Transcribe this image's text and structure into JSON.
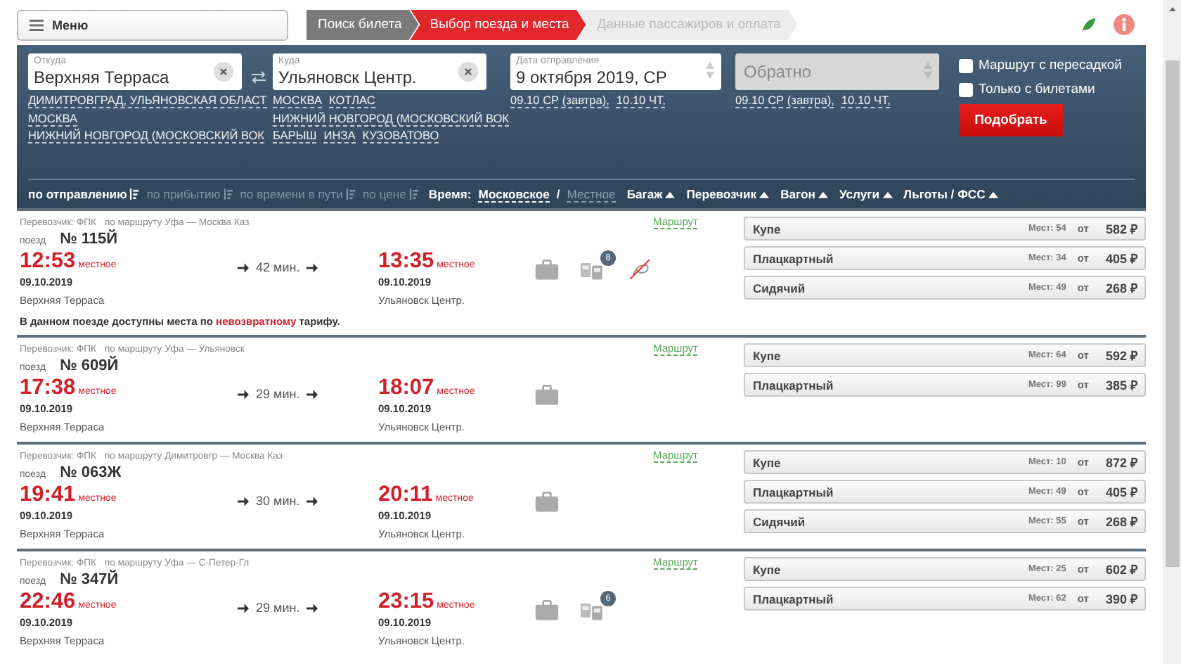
{
  "menu": {
    "label": "Меню"
  },
  "steps": [
    {
      "label": "Поиск билета",
      "kind": "done"
    },
    {
      "label": "Выбор поезда и места",
      "kind": "current"
    },
    {
      "label": "Данные пассажиров и оплата",
      "kind": "pending"
    }
  ],
  "search": {
    "from": {
      "label": "Откуда",
      "value": "Верхняя Терраса",
      "suggestions": [
        [
          "ДИМИТРОВГРАД, УЛЬЯНОВСКАЯ ОБЛАСТ"
        ],
        [
          "МОСКВА"
        ],
        [
          "НИЖНИЙ НОВГОРОД (МОСКОВСКИЙ ВОК"
        ]
      ]
    },
    "to": {
      "label": "Куда",
      "value": "Ульяновск Центр.",
      "suggestions": [
        [
          "МОСКВА",
          "КОТЛАС"
        ],
        [
          "НИЖНИЙ НОВГОРОД (МОСКОВСКИЙ ВОК"
        ],
        [
          "БАРЫШ",
          "ИНЗА",
          "КУЗОВАТОВО"
        ]
      ]
    },
    "date": {
      "label": "Дата отправления",
      "value": "9 октября 2019, СР",
      "quick": [
        "09.10 СР (завтра),",
        "10.10 ЧТ,"
      ]
    },
    "return": {
      "placeholder": "Обратно",
      "quick": [
        "09.10 СР (завтра),",
        "10.10 ЧТ,"
      ]
    },
    "options": [
      {
        "label": "Маршрут с пересадкой",
        "checked": false
      },
      {
        "label": "Только с билетами",
        "checked": false
      }
    ],
    "submit": "Подобрать"
  },
  "sort_bar": {
    "sorts": [
      {
        "label": "по отправлению",
        "selected": true
      },
      {
        "label": "по прибытию",
        "selected": false
      },
      {
        "label": "по времени в пути",
        "selected": false
      },
      {
        "label": "по цене",
        "selected": false
      }
    ],
    "time_label": "Время:",
    "time_separator": "/",
    "time_modes": [
      {
        "label": "Московское",
        "selected": true
      },
      {
        "label": "Местное",
        "selected": false
      }
    ],
    "filters": [
      "Багаж",
      "Перевозчик",
      "Вагон",
      "Услуги",
      "Льготы / ФСС"
    ]
  },
  "trains": [
    {
      "carrier": "Перевозчик: ФПК",
      "route": "по маршруту Уфа — Москва Каз",
      "route_link": "Маршрут",
      "train_label": "поезд",
      "number": "№ 115Й",
      "depart": {
        "time": "12:53",
        "zone": "местное",
        "date": "09.10.2019",
        "station": "Верхняя Терраса"
      },
      "duration": "42 мин.",
      "arrive": {
        "time": "13:35",
        "zone": "местное",
        "date": "09.10.2019",
        "station": "Ульяновск Центр."
      },
      "features": [
        {
          "kind": "luggage"
        },
        {
          "kind": "cars",
          "badge": "8"
        },
        {
          "kind": "no-pets"
        }
      ],
      "note": "В данном поезде доступны места по **невозвратному** тарифу.",
      "classes": [
        {
          "name": "Купе",
          "seats": "Мест: 54",
          "from": "от",
          "price": "582 ₽"
        },
        {
          "name": "Плацкартный",
          "seats": "Мест: 34",
          "from": "от",
          "price": "405 ₽"
        },
        {
          "name": "Сидячий",
          "seats": "Мест: 49",
          "from": "от",
          "price": "268 ₽"
        }
      ]
    },
    {
      "carrier": "Перевозчик: ФПК",
      "route": "по маршруту Уфа — Ульяновск",
      "route_link": "Маршрут",
      "train_label": "поезд",
      "number": "№ 609Й",
      "depart": {
        "time": "17:38",
        "zone": "местное",
        "date": "09.10.2019",
        "station": "Верхняя Терраса"
      },
      "duration": "29 мин.",
      "arrive": {
        "time": "18:07",
        "zone": "местное",
        "date": "09.10.2019",
        "station": "Ульяновск Центр."
      },
      "features": [
        {
          "kind": "luggage"
        }
      ],
      "classes": [
        {
          "name": "Купе",
          "seats": "Мест: 64",
          "from": "от",
          "price": "592 ₽"
        },
        {
          "name": "Плацкартный",
          "seats": "Мест: 99",
          "from": "от",
          "price": "385 ₽"
        }
      ]
    },
    {
      "carrier": "Перевозчик: ФПК",
      "route": "по маршруту Димитровгр — Москва Каз",
      "route_link": "Маршрут",
      "train_label": "поезд",
      "number": "№ 063Ж",
      "depart": {
        "time": "19:41",
        "zone": "местное",
        "date": "09.10.2019",
        "station": "Верхняя Терраса"
      },
      "duration": "30 мин.",
      "arrive": {
        "time": "20:11",
        "zone": "местное",
        "date": "09.10.2019",
        "station": "Ульяновск Центр."
      },
      "features": [
        {
          "kind": "luggage"
        }
      ],
      "classes": [
        {
          "name": "Купе",
          "seats": "Мест: 10",
          "from": "от",
          "price": "872 ₽"
        },
        {
          "name": "Плацкартный",
          "seats": "Мест: 49",
          "from": "от",
          "price": "405 ₽"
        },
        {
          "name": "Сидячий",
          "seats": "Мест: 55",
          "from": "от",
          "price": "268 ₽"
        }
      ]
    },
    {
      "carrier": "Перевозчик: ФПК",
      "route": "по маршруту Уфа — С-Петер-Гл",
      "route_link": "Маршрут",
      "train_label": "поезд",
      "number": "№ 347Й",
      "depart": {
        "time": "22:46",
        "zone": "местное",
        "date": "09.10.2019",
        "station": "Верхняя Терраса"
      },
      "duration": "29 мин.",
      "arrive": {
        "time": "23:15",
        "zone": "местное",
        "date": "09.10.2019",
        "station": "Ульяновск Центр."
      },
      "features": [
        {
          "kind": "luggage"
        },
        {
          "kind": "cars",
          "badge": "6"
        }
      ],
      "classes": [
        {
          "name": "Купе",
          "seats": "Мест: 25",
          "from": "от",
          "price": "602 ₽"
        },
        {
          "name": "Плацкартный",
          "seats": "Мест: 62",
          "from": "от",
          "price": "390 ₽"
        }
      ]
    }
  ]
}
